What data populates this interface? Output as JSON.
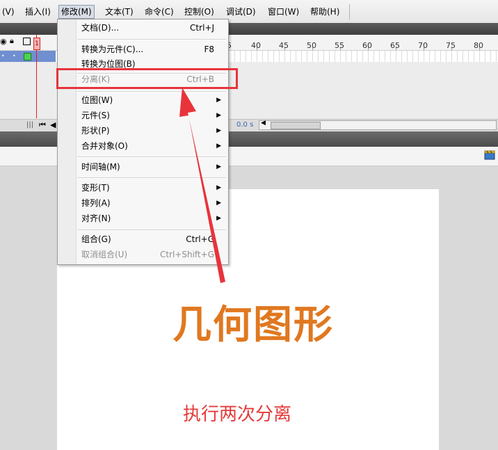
{
  "menubar": {
    "items": [
      {
        "label": "(V)"
      },
      {
        "label": "插入(I)"
      },
      {
        "label": "修改(M)"
      },
      {
        "label": "文本(T)"
      },
      {
        "label": "命令(C)"
      },
      {
        "label": "控制(O)"
      },
      {
        "label": "调试(D)"
      },
      {
        "label": "窗口(W)"
      },
      {
        "label": "帮助(H)"
      }
    ]
  },
  "timeline": {
    "ticks": [
      "5",
      "40",
      "45",
      "50",
      "55",
      "60",
      "65",
      "70",
      "75",
      "80"
    ],
    "time_readout": "0.0 s",
    "frame_marker": "1"
  },
  "modify_menu": {
    "items": [
      {
        "label": "文档(D)...",
        "shortcut": "Ctrl+J"
      },
      {
        "label": "转换为元件(C)...",
        "shortcut": "F8"
      },
      {
        "label": "转换为位图(B)",
        "shortcut": ""
      },
      {
        "label": "分离(K)",
        "shortcut": "Ctrl+B"
      },
      {
        "label": "位图(W)",
        "shortcut": ""
      },
      {
        "label": "元件(S)",
        "shortcut": ""
      },
      {
        "label": "形状(P)",
        "shortcut": ""
      },
      {
        "label": "合并对象(O)",
        "shortcut": ""
      },
      {
        "label": "时间轴(M)",
        "shortcut": ""
      },
      {
        "label": "变形(T)",
        "shortcut": ""
      },
      {
        "label": "排列(A)",
        "shortcut": ""
      },
      {
        "label": "对齐(N)",
        "shortcut": ""
      },
      {
        "label": "组合(G)",
        "shortcut": "Ctrl+G"
      },
      {
        "label": "取消组合(U)",
        "shortcut": "Ctrl+Shift+G"
      }
    ]
  },
  "stage": {
    "title_text": "几何图形",
    "note_text": "执行两次分离"
  },
  "colors": {
    "highlight_box": "#e8333b",
    "title": "#e07820",
    "note": "#e53a3a"
  }
}
